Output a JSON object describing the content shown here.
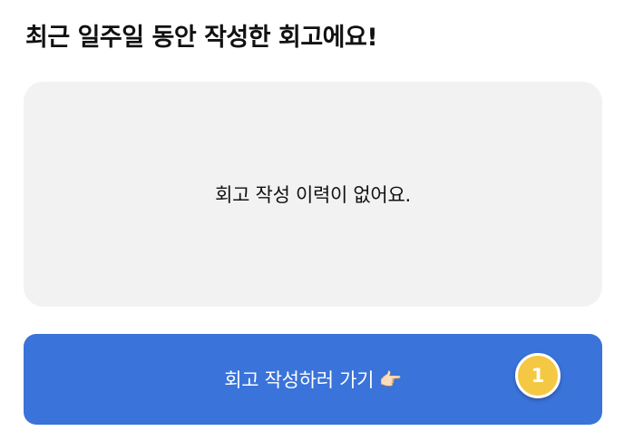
{
  "section": {
    "title": "최근 일주일 동안 작성한 회고에요!"
  },
  "empty_state": {
    "message": "회고 작성 이력이 없어요."
  },
  "cta": {
    "label": "회고 작성하러 가기",
    "icon": "👉🏻",
    "icon_name": "pointing-right-hand-icon",
    "background_color": "#3a73d9"
  },
  "badge": {
    "count": "1",
    "color": "#f5c844"
  }
}
